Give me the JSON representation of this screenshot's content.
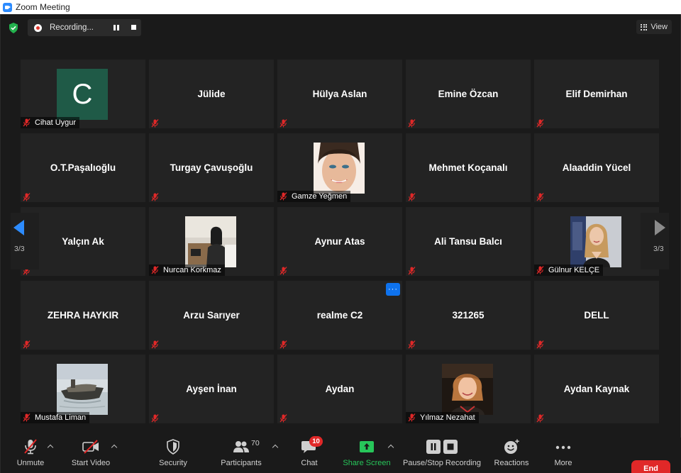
{
  "window": {
    "title": "Zoom Meeting"
  },
  "recording": {
    "status": "Recording..."
  },
  "view": {
    "label": "View"
  },
  "pager": {
    "left_count": "3/3",
    "right_count": "3/3"
  },
  "tiles": [
    {
      "name": "Cihat Uygur",
      "avatar_letter": "C",
      "mode": "avatar"
    },
    {
      "name": "Jülide",
      "mode": "name"
    },
    {
      "name": "Hülya Aslan",
      "mode": "name"
    },
    {
      "name": "Emine Özcan",
      "mode": "name"
    },
    {
      "name": "Elif Demirhan",
      "mode": "name"
    },
    {
      "name": "O.T.Paşalıoğlu",
      "mode": "name"
    },
    {
      "name": "Turgay Çavuşoğlu",
      "mode": "name"
    },
    {
      "name": "Gamze Yeğmen",
      "mode": "photo"
    },
    {
      "name": "Mehmet Koçanalı",
      "mode": "name"
    },
    {
      "name": "Alaaddin Yücel",
      "mode": "name"
    },
    {
      "name": "Yalçın Ak",
      "mode": "name"
    },
    {
      "name": "Nurcan Korkmaz",
      "mode": "photo"
    },
    {
      "name": "Aynur Atas",
      "mode": "name"
    },
    {
      "name": "Ali Tansu Balcı",
      "mode": "name"
    },
    {
      "name": "Gülnur KELÇE",
      "mode": "photo"
    },
    {
      "name": "ZEHRA HAYKIR",
      "mode": "name"
    },
    {
      "name": "Arzu Sarıyer",
      "mode": "name"
    },
    {
      "name": "realme C2",
      "mode": "name",
      "menu": "···"
    },
    {
      "name": "321265",
      "mode": "name"
    },
    {
      "name": "DELL",
      "mode": "name"
    },
    {
      "name": "Mustafa Liman",
      "mode": "photo"
    },
    {
      "name": "Ayşen İnan",
      "mode": "name"
    },
    {
      "name": "Aydan",
      "mode": "name"
    },
    {
      "name": "Yılmaz Nezahat",
      "mode": "photo"
    },
    {
      "name": "Aydan Kaynak",
      "mode": "name"
    }
  ],
  "toolbar": {
    "unmute": "Unmute",
    "start_video": "Start Video",
    "security": "Security",
    "participants": "Participants",
    "participants_count": "70",
    "chat": "Chat",
    "chat_badge": "10",
    "share_screen": "Share Screen",
    "pause_stop_recording": "Pause/Stop Recording",
    "reactions": "Reactions",
    "more": "More",
    "end": "End"
  },
  "colors": {
    "accent": "#2d8cff",
    "share_green": "#27c65a",
    "end_red": "#e02828",
    "mute_red": "#e02828"
  }
}
